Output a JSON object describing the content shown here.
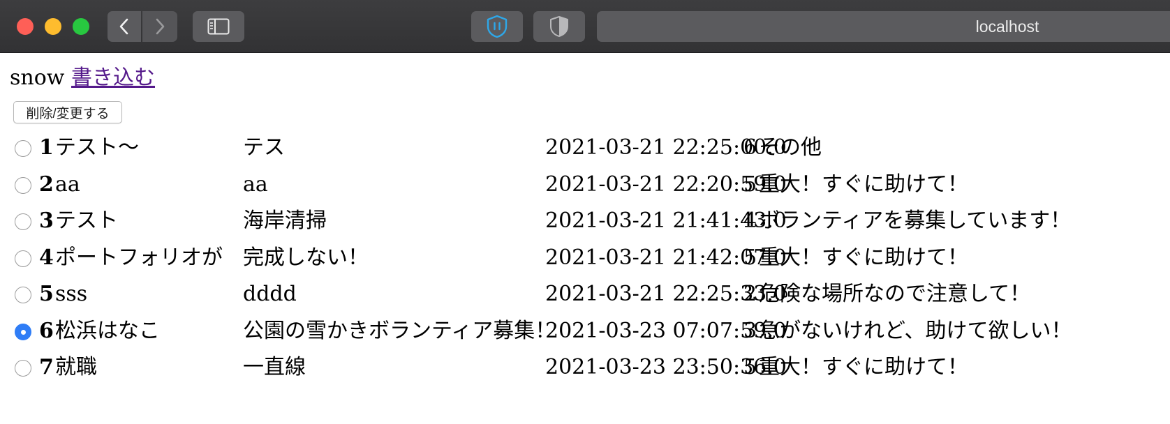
{
  "browser": {
    "url": "localhost"
  },
  "page": {
    "username": "snow",
    "write_link": "書き込む",
    "delete_button": "削除/変更する"
  },
  "rows": [
    {
      "id": "1",
      "title": "テスト〜",
      "body": "テス",
      "datetime": "2021-03-21 22:25:00.0",
      "level": "6",
      "category": "その他",
      "selected": false
    },
    {
      "id": "2",
      "title": "aa",
      "body": "aa",
      "datetime": "2021-03-21 22:20:59.0",
      "level": "5",
      "category": "重大！すぐに助けて！",
      "selected": false
    },
    {
      "id": "3",
      "title": "テスト",
      "body": "海岸清掃",
      "datetime": "2021-03-21 21:41:43.0",
      "level": "4",
      "category": "ボランティアを募集しています！",
      "selected": false
    },
    {
      "id": "4",
      "title": "ポートフォリオが",
      "body": "完成しない！",
      "datetime": "2021-03-21 21:42:07.0",
      "level": "5",
      "category": "重大！すぐに助けて！",
      "selected": false
    },
    {
      "id": "5",
      "title": "sss",
      "body": "dddd",
      "datetime": "2021-03-21 22:25:33.0",
      "level": "2",
      "category": "危険な場所なので注意して！",
      "selected": false
    },
    {
      "id": "6",
      "title": "松浜はなこ",
      "body": "公園の雪かきボランティア募集！",
      "datetime": "2021-03-23 07:07:59.0",
      "level": "3",
      "category": "急がないけれど、助けて欲しい！",
      "selected": true
    },
    {
      "id": "7",
      "title": "就職",
      "body": "一直線",
      "datetime": "2021-03-23 23:50:36.0",
      "level": "5",
      "category": "重大！すぐに助けて！",
      "selected": false
    }
  ]
}
